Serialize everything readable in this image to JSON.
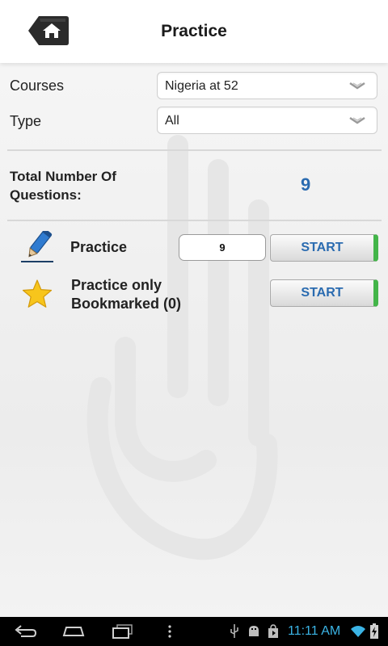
{
  "header": {
    "title": "Practice",
    "home_icon": "home-icon"
  },
  "form": {
    "courses": {
      "label": "Courses",
      "value": "Nigeria at 52"
    },
    "type": {
      "label": "Type",
      "value": "All"
    }
  },
  "total": {
    "label": "Total Number Of Questions:",
    "value": "9"
  },
  "practice": {
    "label": "Practice",
    "count": "9",
    "start_label": "START",
    "icon": "pencil-icon"
  },
  "bookmarked": {
    "label_line1": "Practice only",
    "label_line2": "Bookmarked (0)",
    "start_label": "START",
    "icon": "star-icon"
  },
  "status_bar": {
    "time": "11:11 AM"
  },
  "colors": {
    "accent_blue": "#2a6bb0",
    "start_green": "#43b549",
    "clock_blue": "#3bb4e5"
  }
}
